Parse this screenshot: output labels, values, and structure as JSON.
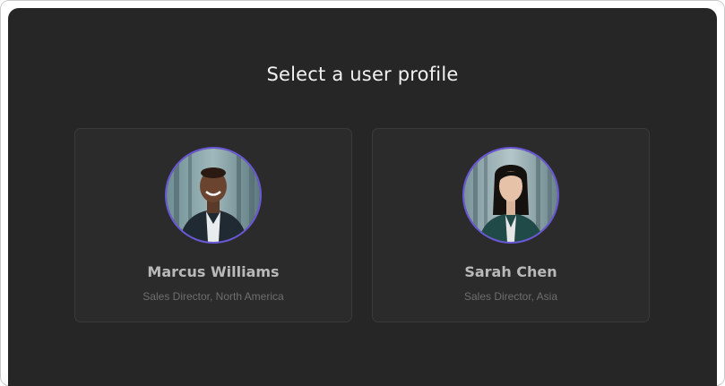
{
  "page": {
    "title": "Select a user profile"
  },
  "profiles": [
    {
      "name": "Marcus Williams",
      "role": "Sales Director, North America",
      "avatar_icon": "person-avatar-photo"
    },
    {
      "name": "Sarah Chen",
      "role": "Sales Director, Asia",
      "avatar_icon": "person-avatar-photo"
    }
  ],
  "colors": {
    "background": "#262626",
    "card": "#2b2b2b",
    "avatar_ring": "#6a57d9",
    "title_text": "#f2f2f2"
  }
}
